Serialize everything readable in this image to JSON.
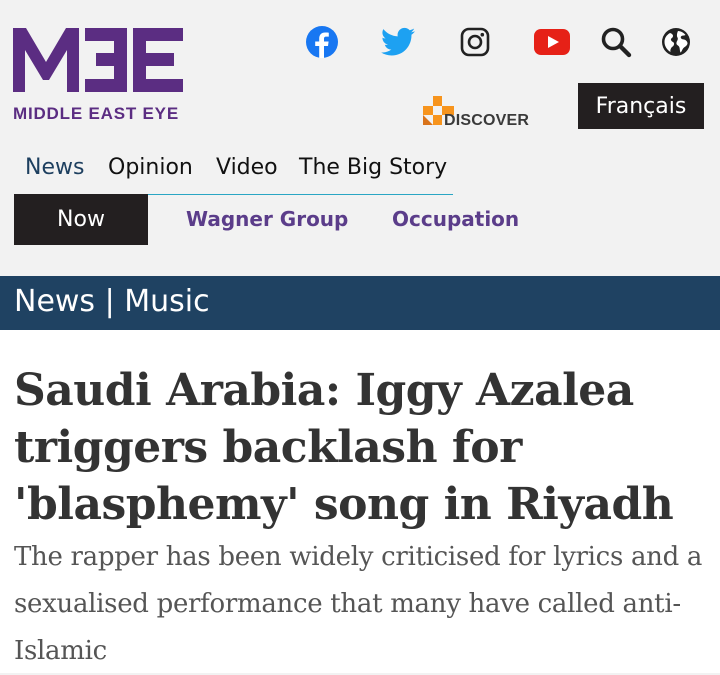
{
  "brand": {
    "logo_letters": "MEE",
    "name": "MIDDLE EAST EYE",
    "color": "#5b2d82"
  },
  "social": [
    {
      "name": "facebook-icon",
      "color": "#1877f2"
    },
    {
      "name": "twitter-icon",
      "color": "#1da1f2"
    },
    {
      "name": "instagram-icon",
      "color": "#222222"
    },
    {
      "name": "youtube-icon",
      "color": "#e62117"
    },
    {
      "name": "search-icon",
      "color": "#222222"
    },
    {
      "name": "globe-icon",
      "color": "#222222"
    }
  ],
  "discover": {
    "label": "DISCOVER",
    "accent": "#f7941d"
  },
  "language_button": "Français",
  "main_nav": {
    "items": [
      {
        "label": "News",
        "active": true
      },
      {
        "label": "Opinion",
        "active": false
      },
      {
        "label": "Video",
        "active": false
      },
      {
        "label": "The Big Story",
        "active": false
      }
    ],
    "underline_color": "#2aa6c4"
  },
  "sub_nav": {
    "now_label": "Now",
    "links": [
      "Wagner Group",
      "Occupation"
    ]
  },
  "section": {
    "category": "News",
    "separator": "|",
    "topic": "Music",
    "background": "#1f4262"
  },
  "article": {
    "headline": "Saudi Arabia: Iggy Azalea triggers backlash for 'blasphemy' song in Riyadh",
    "standfirst": "The rapper has been widely criticised for lyrics and a sexualised performance that many have called anti-Islamic"
  }
}
